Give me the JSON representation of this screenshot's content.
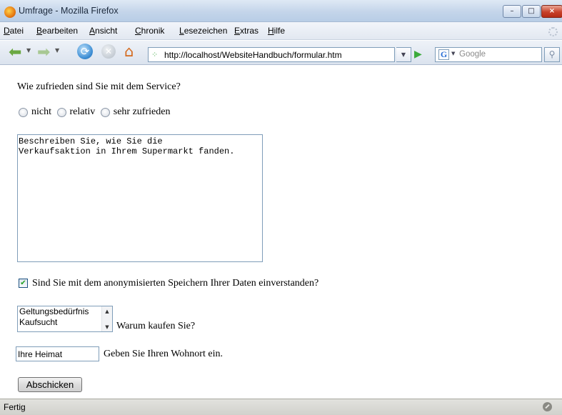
{
  "window": {
    "title": "Umfrage - Mozilla Firefox",
    "min_glyph": "–",
    "max_glyph": "□",
    "close_glyph": "×"
  },
  "menu": [
    "Datei",
    "Bearbeiten",
    "Ansicht",
    "Chronik",
    "Lesezeichen",
    "Extras",
    "Hilfe"
  ],
  "navigation": {
    "url": "http://localhost/WebsiteHandbuch/formular.htm",
    "search_placeholder": "Google",
    "search_engine_letter": "G"
  },
  "form": {
    "question": "Wie zufrieden sind Sie mit dem Service?",
    "radio_options": [
      "nicht",
      "relativ",
      "sehr zufrieden"
    ],
    "textarea_text": "Beschreiben Sie, wie Sie die\nVerkaufsaktion in Ihrem Supermarkt fanden.",
    "consent_label": "Sind Sie mit dem anonymisierten Speichern Ihrer Daten einverstanden?",
    "consent_checked": true,
    "list_options": [
      "Geltungsbedürfnis",
      "Kaufsucht"
    ],
    "list_caption": "Warum kaufen Sie?",
    "city_value": "Ihre Heimat",
    "city_caption": "Geben Sie Ihren Wohnort ein.",
    "submit_label": "Abschicken"
  },
  "status": {
    "text": "Fertig"
  },
  "colors": {
    "accent_green": "#3cab3c",
    "link_blue": "#2b6fd6",
    "close_red": "#c7412a"
  }
}
